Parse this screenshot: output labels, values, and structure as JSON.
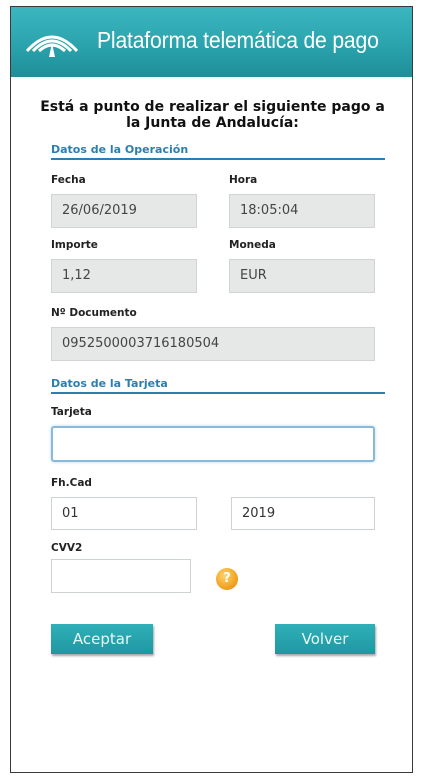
{
  "header": {
    "title": "Plataforma telemática de pago"
  },
  "intro": {
    "line1": "Está a punto de realizar el siguiente pago a",
    "line2": "la Junta de Andalucía:"
  },
  "operation": {
    "section_title": "Datos de la Operación",
    "fecha_label": "Fecha",
    "fecha_value": "26/06/2019",
    "hora_label": "Hora",
    "hora_value": "18:05:04",
    "importe_label": "Importe",
    "importe_value": "1,12",
    "moneda_label": "Moneda",
    "moneda_value": "EUR",
    "documento_label": "Nº Documento",
    "documento_value": "0952500003716180504"
  },
  "card": {
    "section_title": "Datos de la Tarjeta",
    "tarjeta_label": "Tarjeta",
    "tarjeta_value": "",
    "fhcad_label": "Fh.Cad",
    "month_value": "01",
    "year_value": "2019",
    "cvv_label": "CVV2",
    "cvv_value": "",
    "help_symbol": "?"
  },
  "actions": {
    "accept_label": "Aceptar",
    "back_label": "Volver"
  },
  "colors": {
    "header": "#2aa3ad",
    "accent": "#2a7fb0",
    "button": "#1f97a1"
  },
  "icons": {
    "logo": "junta-andalucia-arch-logo-icon",
    "help": "help-icon"
  }
}
